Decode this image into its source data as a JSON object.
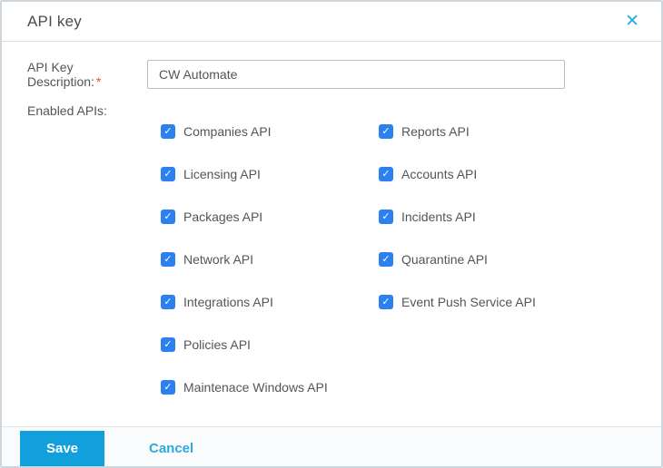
{
  "dialog": {
    "title": "API key",
    "close_icon": "✕"
  },
  "form": {
    "description_label": "API Key Description:",
    "required_marker": "*",
    "description_value": "CW Automate",
    "enabled_apis_label": "Enabled APIs:"
  },
  "checkboxes": {
    "check_glyph": "✓",
    "left": [
      {
        "label": "Companies API",
        "checked": true
      },
      {
        "label": "Licensing API",
        "checked": true
      },
      {
        "label": "Packages API",
        "checked": true
      },
      {
        "label": "Network API",
        "checked": true
      },
      {
        "label": "Integrations API",
        "checked": true
      },
      {
        "label": "Policies API",
        "checked": true
      },
      {
        "label": "Maintenace Windows API",
        "checked": true
      }
    ],
    "right": [
      {
        "label": "Reports API",
        "checked": true
      },
      {
        "label": "Accounts API",
        "checked": true
      },
      {
        "label": "Incidents API",
        "checked": true
      },
      {
        "label": "Quarantine API",
        "checked": true
      },
      {
        "label": "Event Push Service API",
        "checked": true
      }
    ]
  },
  "footer": {
    "save_label": "Save",
    "cancel_label": "Cancel"
  },
  "colors": {
    "accent_cyan": "#29abe2",
    "checkbox_blue": "#2d80f0",
    "save_button_blue": "#12a0dc",
    "required_red": "#e74c3c"
  }
}
